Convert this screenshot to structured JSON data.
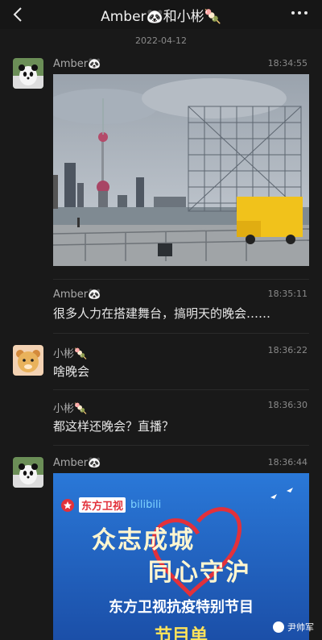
{
  "header": {
    "title": "Amber🐼和小彬🍡",
    "back_icon": "chevron-left-icon",
    "more_icon": "more-dots-icon"
  },
  "date_separator": "2022-04-12",
  "messages": [
    {
      "sender": "Amber🐼",
      "time": "18:34:55",
      "type": "image",
      "avatar": "panda-avatar",
      "description": "photo"
    },
    {
      "sender": "Amber🐼",
      "time": "18:35:11",
      "type": "text",
      "text": "很多人力在搭建舞台，搞明天的晚会……"
    },
    {
      "sender": "小彬🍡",
      "time": "18:36:22",
      "type": "text",
      "text": "啥晚会",
      "avatar": "cartoon-avatar"
    },
    {
      "sender": "小彬🍡",
      "time": "18:36:30",
      "type": "text",
      "text": "都这样还晚会？直播？"
    },
    {
      "sender": "Amber🐼",
      "time": "18:36:44",
      "type": "image",
      "avatar": "panda-avatar"
    }
  ],
  "poster": {
    "channel_logo": "东方卫视",
    "partner_logo": "bilibili",
    "slogan_line1": "众志成城",
    "slogan_line2": "同心守沪",
    "subtitle": "东方卫视抗疫特别节目",
    "program_label": "节目单"
  },
  "watermark": "尹帅军",
  "colors": {
    "background": "#191919",
    "poster_blue": "#1f5fc0",
    "truck_yellow": "#f1c21b"
  }
}
